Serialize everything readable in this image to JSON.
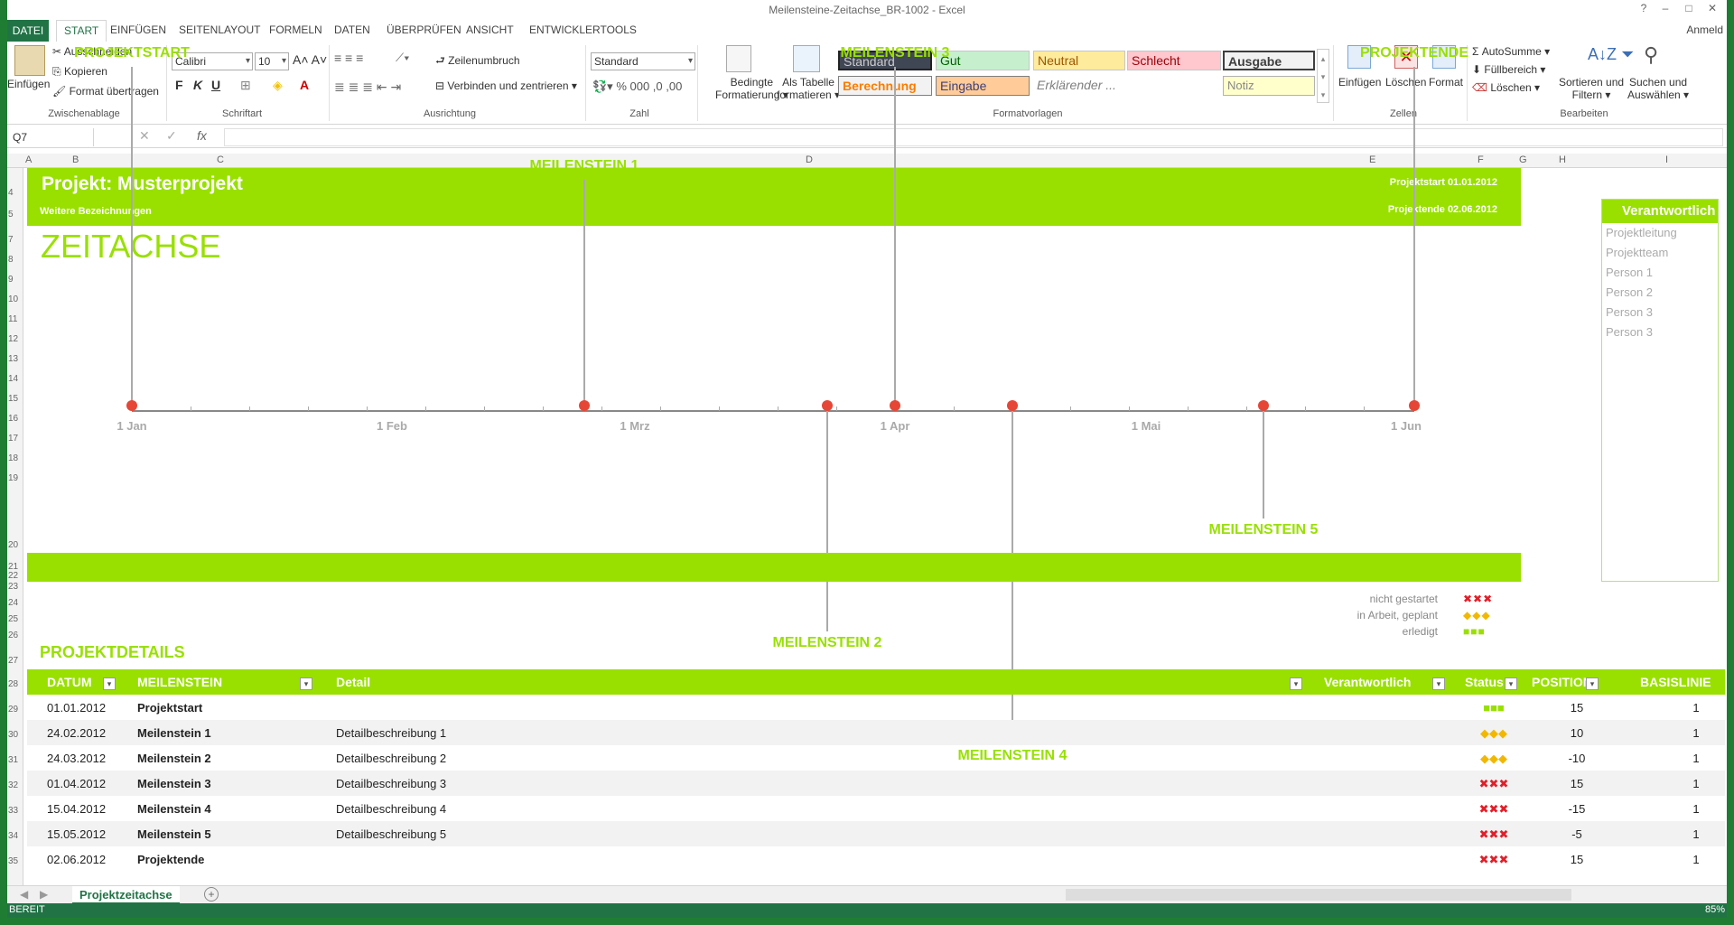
{
  "window": {
    "title": "Meilensteine-Zeitachse_BR-1002 - Excel",
    "user": "Anmeld"
  },
  "tabs": [
    "DATEI",
    "START",
    "EINFÜGEN",
    "SEITENLAYOUT",
    "FORMELN",
    "DATEN",
    "ÜBERPRÜFEN",
    "ANSICHT",
    "ENTWICKLERTOOLS"
  ],
  "ribbon": {
    "clipboard": {
      "paste": "Einfügen",
      "cut": "Ausschneiden",
      "copy": "Kopieren",
      "painter": "Format übertragen",
      "group": "Zwischenablage"
    },
    "font": {
      "name": "Calibri",
      "size": "10",
      "bold": "F",
      "italic": "K",
      "underline": "U",
      "group": "Schriftart"
    },
    "align": {
      "wrap": "Zeilenumbruch",
      "merge": "Verbinden und zentrieren",
      "group": "Ausrichtung"
    },
    "number": {
      "format": "Standard",
      "group": "Zahl"
    },
    "cond": {
      "l1": "Bedingte",
      "l2": "Formatierung"
    },
    "table": {
      "l1": "Als Tabelle",
      "l2": "formatieren"
    },
    "styles": {
      "standard": "Standard",
      "gut": "Gut",
      "neutral": "Neutral",
      "schlecht": "Schlecht",
      "ausgabe": "Ausgabe",
      "berechnung": "Berechnung",
      "eingabe": "Eingabe",
      "erkl": "Erklärender ...",
      "notiz": "Notiz",
      "group": "Formatvorlagen"
    },
    "cells": {
      "insert": "Einfügen",
      "delete": "Löschen",
      "format": "Format",
      "group": "Zellen"
    },
    "edit": {
      "autosum": "AutoSumme",
      "fill": "Füllbereich",
      "clear": "Löschen",
      "sort1": "Sortieren und",
      "sort2": "Filtern",
      "find1": "Suchen und",
      "find2": "Auswählen",
      "group": "Bearbeiten"
    }
  },
  "namebox": "Q7",
  "columns": [
    "A",
    "B",
    "C",
    "D",
    "E",
    "F",
    "G",
    "H",
    "I"
  ],
  "rows": [
    "4",
    "5",
    "7",
    "8",
    "9",
    "10",
    "11",
    "12",
    "13",
    "14",
    "15",
    "16",
    "17",
    "18",
    "19",
    "20",
    "21",
    "22",
    "23",
    "24",
    "25",
    "26",
    "27",
    "28",
    "29",
    "30",
    "31",
    "32",
    "33",
    "34",
    "35"
  ],
  "project": {
    "title": "Projekt: Musterprojekt",
    "subtitle": "Weitere Bezeichnungen",
    "start_label": "Projektstart",
    "start": "01.01.2012",
    "end_label": "Projektende",
    "end": "02.06.2012"
  },
  "timeline": {
    "heading": "ZEITACHSE",
    "months": [
      "1 Jan",
      "1 Feb",
      "1 Mrz",
      "1 Apr",
      "1 Mai",
      "1 Jun"
    ],
    "milestones": [
      {
        "label": "PROJEKTSTART",
        "date": "01.01.2012",
        "position": 15
      },
      {
        "label": "MEILENSTEIN 1",
        "date": "24.02.2012",
        "position": 10
      },
      {
        "label": "MEILENSTEIN 2",
        "date": "24.03.2012",
        "position": -10
      },
      {
        "label": "MEILENSTEIN 3",
        "date": "01.04.2012",
        "position": 15
      },
      {
        "label": "MEILENSTEIN 4",
        "date": "15.04.2012",
        "position": -15
      },
      {
        "label": "MEILENSTEIN 5",
        "date": "15.05.2012",
        "position": -5
      },
      {
        "label": "PROJEKTENDE",
        "date": "02.06.2012",
        "position": 15
      }
    ]
  },
  "responsible": {
    "header": "Verantwortlich",
    "items": [
      "Projektleitung",
      "Projektteam",
      "Person 1",
      "Person 2",
      "Person 3",
      "Person 3"
    ]
  },
  "legend": [
    {
      "text": "nicht gestartet",
      "marks": "✖✖✖",
      "color": "#e0202a"
    },
    {
      "text": "in Arbeit, geplant",
      "marks": "◆◆◆",
      "color": "#f2b800"
    },
    {
      "text": "erledigt",
      "marks": "■■■",
      "color": "#99e000"
    }
  ],
  "details": {
    "heading": "PROJEKTDETAILS",
    "headers": [
      "DATUM",
      "MEILENSTEIN",
      "Detail",
      "Verantwortlich",
      "Status",
      "POSITION",
      "BASISLINIE"
    ],
    "rows": [
      {
        "date": "01.01.2012",
        "name": "Projektstart",
        "detail": "",
        "status": "■■■",
        "status_color": "#99e000",
        "pos": "15",
        "base": "1"
      },
      {
        "date": "24.02.2012",
        "name": "Meilenstein 1",
        "detail": "Detailbeschreibung 1",
        "status": "◆◆◆",
        "status_color": "#f2b800",
        "pos": "10",
        "base": "1"
      },
      {
        "date": "24.03.2012",
        "name": "Meilenstein 2",
        "detail": "Detailbeschreibung 2",
        "status": "◆◆◆",
        "status_color": "#f2b800",
        "pos": "-10",
        "base": "1"
      },
      {
        "date": "01.04.2012",
        "name": "Meilenstein 3",
        "detail": "Detailbeschreibung 3",
        "status": "✖✖✖",
        "status_color": "#e0202a",
        "pos": "15",
        "base": "1"
      },
      {
        "date": "15.04.2012",
        "name": "Meilenstein 4",
        "detail": "Detailbeschreibung 4",
        "status": "✖✖✖",
        "status_color": "#e0202a",
        "pos": "-15",
        "base": "1"
      },
      {
        "date": "15.05.2012",
        "name": "Meilenstein 5",
        "detail": "Detailbeschreibung 5",
        "status": "✖✖✖",
        "status_color": "#e0202a",
        "pos": "-5",
        "base": "1"
      },
      {
        "date": "02.06.2012",
        "name": "Projektende",
        "detail": "",
        "status": "✖✖✖",
        "status_color": "#e0202a",
        "pos": "15",
        "base": "1"
      }
    ]
  },
  "sheet": {
    "tab": "Projektzeitachse",
    "add": "+"
  },
  "status": {
    "ready": "BEREIT",
    "zoom": "85%"
  },
  "colors": {
    "accent": "#99e000",
    "excel": "#217346",
    "dot": "#e64636"
  }
}
